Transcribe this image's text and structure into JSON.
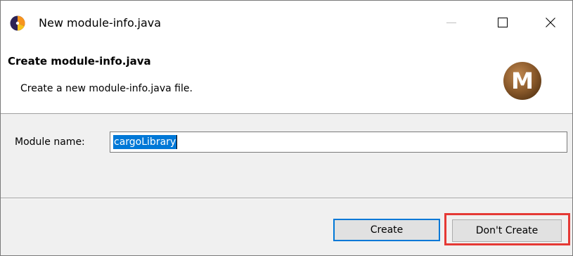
{
  "window": {
    "title": "New module-info.java"
  },
  "banner": {
    "title": "Create module-info.java",
    "description": "Create a new module-info.java file.",
    "logo_letter": "M"
  },
  "form": {
    "module_name_label": "Module name:",
    "module_name_value": "cargoLibrary"
  },
  "buttons": {
    "create_label": "Create",
    "dont_create_label": "Don't Create"
  },
  "colors": {
    "accent": "#0078d7",
    "highlight_box": "#e53935",
    "logo_brown": "#8b5a2b"
  },
  "icons": {
    "app": "eclipse-icon",
    "minimize": "minimize-icon",
    "maximize": "maximize-icon",
    "close": "close-icon",
    "logo": "maven-logo-icon"
  }
}
